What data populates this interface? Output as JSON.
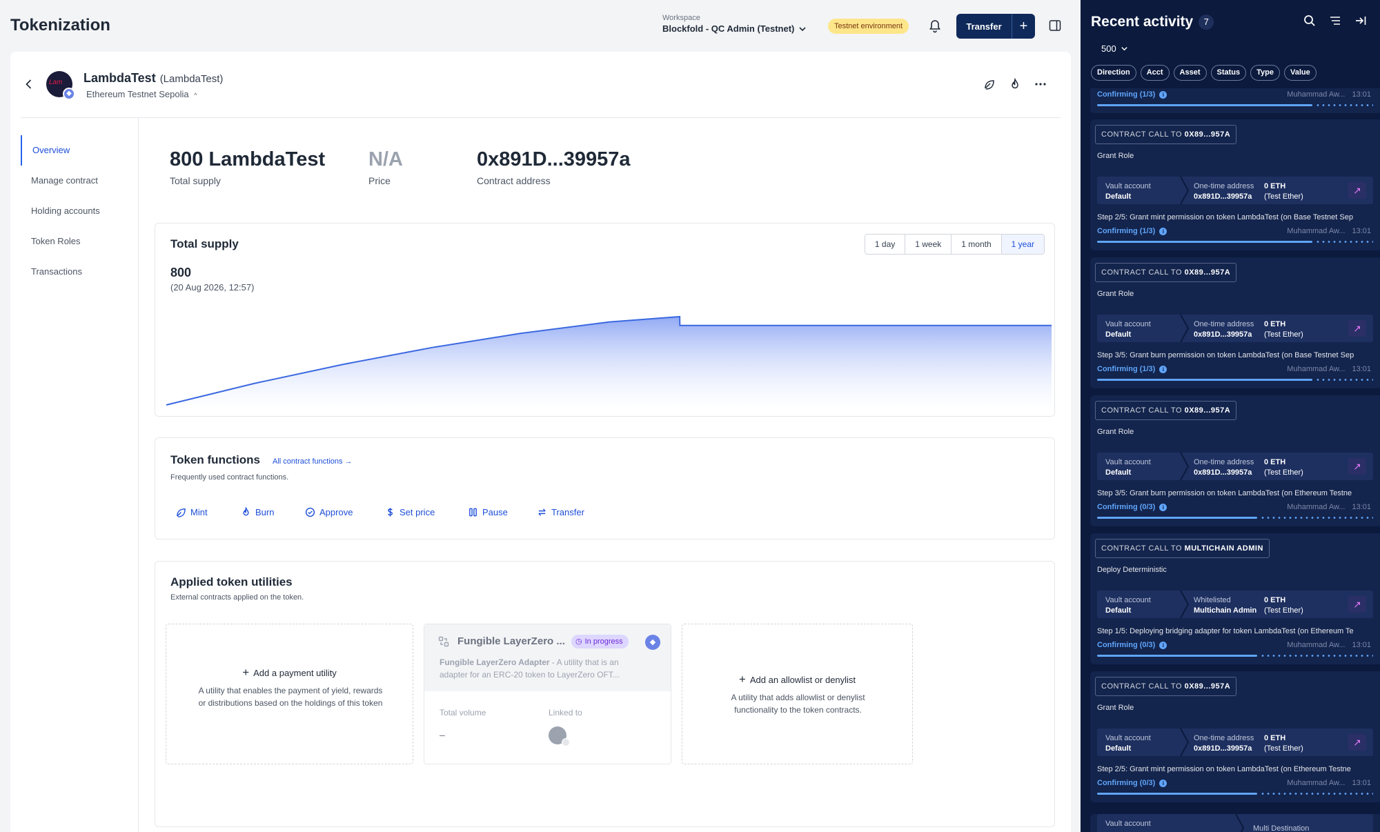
{
  "app": {
    "title": "Tokenization"
  },
  "workspace": {
    "label": "Workspace",
    "value": "Blockfold - QC Admin (Testnet)"
  },
  "environment_badge": "Testnet environment",
  "transfer_button": {
    "label": "Transfer"
  },
  "token": {
    "name": "LambdaTest",
    "symbol": "(LambdaTest)",
    "network": "Ethereum Testnet Sepolia",
    "avatar_text": "Lam"
  },
  "nav": {
    "items": [
      {
        "label": "Overview",
        "active": true
      },
      {
        "label": "Manage contract"
      },
      {
        "label": "Holding accounts"
      },
      {
        "label": "Token Roles"
      },
      {
        "label": "Transactions"
      }
    ]
  },
  "stats": {
    "supply": {
      "value": "800 LambdaTest",
      "label": "Total supply"
    },
    "price": {
      "value": "N/A",
      "label": "Price"
    },
    "contract": {
      "value": "0x891D...39957a",
      "label": "Contract address"
    }
  },
  "supply_card": {
    "title": "Total supply",
    "value": "800",
    "timestamp": "(20 Aug 2026, 12:57)",
    "ranges": [
      "1 day",
      "1 week",
      "1 month",
      "1 year"
    ],
    "active_range": "1 year"
  },
  "chart_data": {
    "type": "area",
    "title": "Total supply",
    "range": "1 year",
    "x": [
      0,
      10,
      20,
      30,
      40,
      50,
      58,
      58.01,
      70,
      80,
      90,
      100
    ],
    "values": [
      0,
      196,
      368,
      520,
      648,
      752,
      800,
      720,
      720,
      720,
      720,
      720
    ],
    "ylim": [
      0,
      800
    ],
    "grid": false,
    "accent": "#3b68e0"
  },
  "token_functions": {
    "title": "Token functions",
    "link": "All contract functions →",
    "subtitle": "Frequently used contract functions.",
    "items": [
      {
        "label": "Mint",
        "icon": "leaf-icon"
      },
      {
        "label": "Burn",
        "icon": "flame-icon"
      },
      {
        "label": "Approve",
        "icon": "check-circle-icon"
      },
      {
        "label": "Set price",
        "icon": "dollar-icon"
      },
      {
        "label": "Pause",
        "icon": "pause-icon"
      },
      {
        "label": "Transfer",
        "icon": "arrows-swap-icon"
      }
    ]
  },
  "utilities": {
    "title": "Applied token utilities",
    "subtitle": "External contracts applied on the token.",
    "payment": {
      "action": "Add a payment utility",
      "description": "A utility that enables the payment of yield, rewards or distributions based on the holdings of this token"
    },
    "layerzero": {
      "title": "Fungible LayerZero ...",
      "status": "In progress",
      "description_bold": "Fungible LayerZero Adapter",
      "description": " - A utility that is an adapter for an ERC-20 token to LayerZero OFT...",
      "volume_label": "Total volume",
      "volume_value": "–",
      "linked_label": "Linked to"
    },
    "allowlist": {
      "action": "Add an allowlist or denylist",
      "description": "A utility that adds allowlist or denylist functionality to the token contracts."
    }
  },
  "activity": {
    "title": "Recent activity",
    "count": "7",
    "limit": "500",
    "filters": [
      "Direction",
      "Acct",
      "Asset",
      "Status",
      "Type",
      "Value"
    ],
    "top_partial": {
      "status": "Confirming (1/3)",
      "user": "Muhammad Aw...",
      "time": "13:01",
      "progress": 0.78
    },
    "items": [
      {
        "tag_prefix": "CONTRACT CALL TO",
        "tag_target": "0X89...957A",
        "name": "Grant Role",
        "from_label": "Vault account",
        "from_value": "Default",
        "to_label": "One-time address",
        "to_value": "0x891D...39957a",
        "amount": "0 ETH",
        "asset": "(Test Ether)",
        "step": "Step 2/5: Grant mint permission on token LambdaTest (on Base Testnet Sep",
        "status": "Confirming (1/3)",
        "user": "Muhammad Aw...",
        "time": "13:01",
        "progress": 0.78
      },
      {
        "tag_prefix": "CONTRACT CALL TO",
        "tag_target": "0X89...957A",
        "name": "Grant Role",
        "from_label": "Vault account",
        "from_value": "Default",
        "to_label": "One-time address",
        "to_value": "0x891D...39957a",
        "amount": "0 ETH",
        "asset": "(Test Ether)",
        "step": "Step 3/5: Grant burn permission on token LambdaTest (on Base Testnet Sep",
        "status": "Confirming (1/3)",
        "user": "Muhammad Aw...",
        "time": "13:01",
        "progress": 0.78
      },
      {
        "tag_prefix": "CONTRACT CALL TO",
        "tag_target": "0X89...957A",
        "name": "Grant Role",
        "from_label": "Vault account",
        "from_value": "Default",
        "to_label": "One-time address",
        "to_value": "0x891D...39957a",
        "amount": "0 ETH",
        "asset": "(Test Ether)",
        "step": "Step 3/5: Grant burn permission on token LambdaTest (on Ethereum Testne",
        "status": "Confirming (0/3)",
        "user": "Muhammad Aw...",
        "time": "13:01",
        "progress": 0.58
      },
      {
        "tag_prefix": "CONTRACT CALL TO",
        "tag_target": "MULTICHAIN ADMIN",
        "name": "Deploy Deterministic",
        "from_label": "Vault account",
        "from_value": "Default",
        "to_label": "Whitelisted",
        "to_value": "Multichain Admin",
        "amount": "0 ETH",
        "asset": "(Test Ether)",
        "step": "Step 1/5: Deploying bridging adapter for token LambdaTest (on Ethereum Te",
        "status": "Confirming (0/3)",
        "user": "Muhammad Aw...",
        "time": "13:01",
        "progress": 0.58
      },
      {
        "tag_prefix": "CONTRACT CALL TO",
        "tag_target": "0X89...957A",
        "name": "Grant Role",
        "from_label": "Vault account",
        "from_value": "Default",
        "to_label": "One-time address",
        "to_value": "0x891D...39957a",
        "amount": "0 ETH",
        "asset": "(Test Ether)",
        "step": "Step 2/5: Grant mint permission on token LambdaTest (on Ethereum Testne",
        "status": "Confirming (0/3)",
        "user": "Muhammad Aw...",
        "time": "13:01",
        "progress": 0.58
      }
    ],
    "bottom_partial": {
      "from_label": "Vault account",
      "to_label": "Multi Destination"
    }
  }
}
